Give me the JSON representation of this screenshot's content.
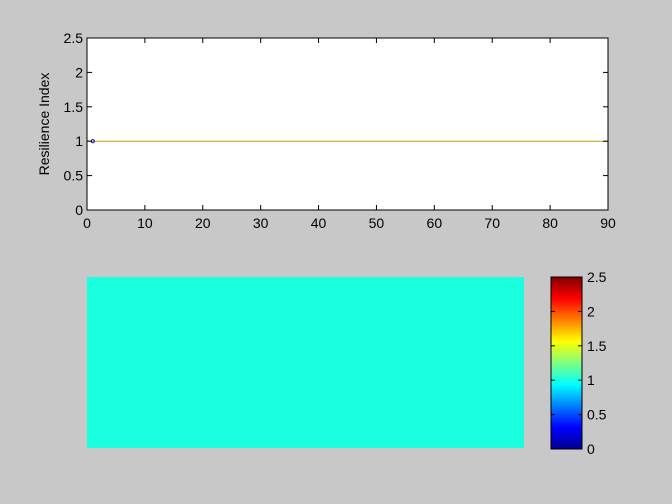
{
  "figure": {
    "background": "#c8c8c8"
  },
  "chart_data": [
    {
      "type": "line",
      "title": "",
      "xlabel": "",
      "ylabel": "Resilience Index",
      "xlim": [
        0,
        90
      ],
      "ylim": [
        0,
        2.5
      ],
      "xticks": [
        0,
        10,
        20,
        30,
        40,
        50,
        60,
        70,
        80,
        90
      ],
      "yticks": [
        0,
        0.5,
        1,
        1.5,
        2,
        2.5
      ],
      "x_tick_labels": [
        "0",
        "10",
        "20",
        "30",
        "40",
        "50",
        "60",
        "70",
        "80",
        "90"
      ],
      "y_tick_labels": [
        "0",
        "0.5",
        "1",
        "1.5",
        "2",
        "2.5"
      ],
      "grid": false,
      "series": [
        {
          "kind": "line",
          "color": "#cc9900",
          "x": [
            0,
            90
          ],
          "y": [
            1,
            1
          ]
        },
        {
          "kind": "marker",
          "color": "#0000cc",
          "x": [
            1
          ],
          "y": [
            1
          ]
        }
      ]
    },
    {
      "type": "heatmap",
      "title": "",
      "fill_value": 1,
      "fill_color": "#1affdd",
      "colormap": "jet",
      "colorbar": {
        "range": [
          0,
          2.5
        ],
        "ticks": [
          0,
          0.5,
          1,
          1.5,
          2,
          2.5
        ],
        "tick_labels": [
          "0",
          "0.5",
          "1",
          "1.5",
          "2",
          "2.5"
        ]
      }
    }
  ]
}
